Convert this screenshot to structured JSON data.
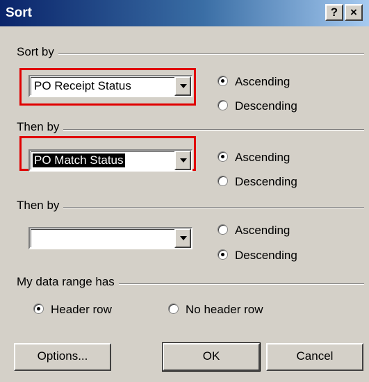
{
  "window": {
    "title": "Sort",
    "help_button": "?",
    "close_button": "×"
  },
  "sort_by": {
    "label": "Sort by",
    "value": "PO Receipt Status",
    "radio_ascending": "Ascending",
    "radio_descending": "Descending",
    "selected": "ascending"
  },
  "then_by_1": {
    "label": "Then by",
    "value": "PO Match Status",
    "radio_ascending": "Ascending",
    "radio_descending": "Descending",
    "selected": "ascending"
  },
  "then_by_2": {
    "label": "Then by",
    "value": "",
    "radio_ascending": "Ascending",
    "radio_descending": "Descending",
    "selected": "descending"
  },
  "data_range": {
    "label": "My data range has",
    "header_row": "Header row",
    "no_header_row": "No header row",
    "selected": "header_row"
  },
  "buttons": {
    "options": "Options...",
    "ok": "OK",
    "cancel": "Cancel"
  },
  "colors": {
    "highlight": "#e00000",
    "title_bar": "#0a246a",
    "dialog_bg": "#d4d0c8"
  }
}
